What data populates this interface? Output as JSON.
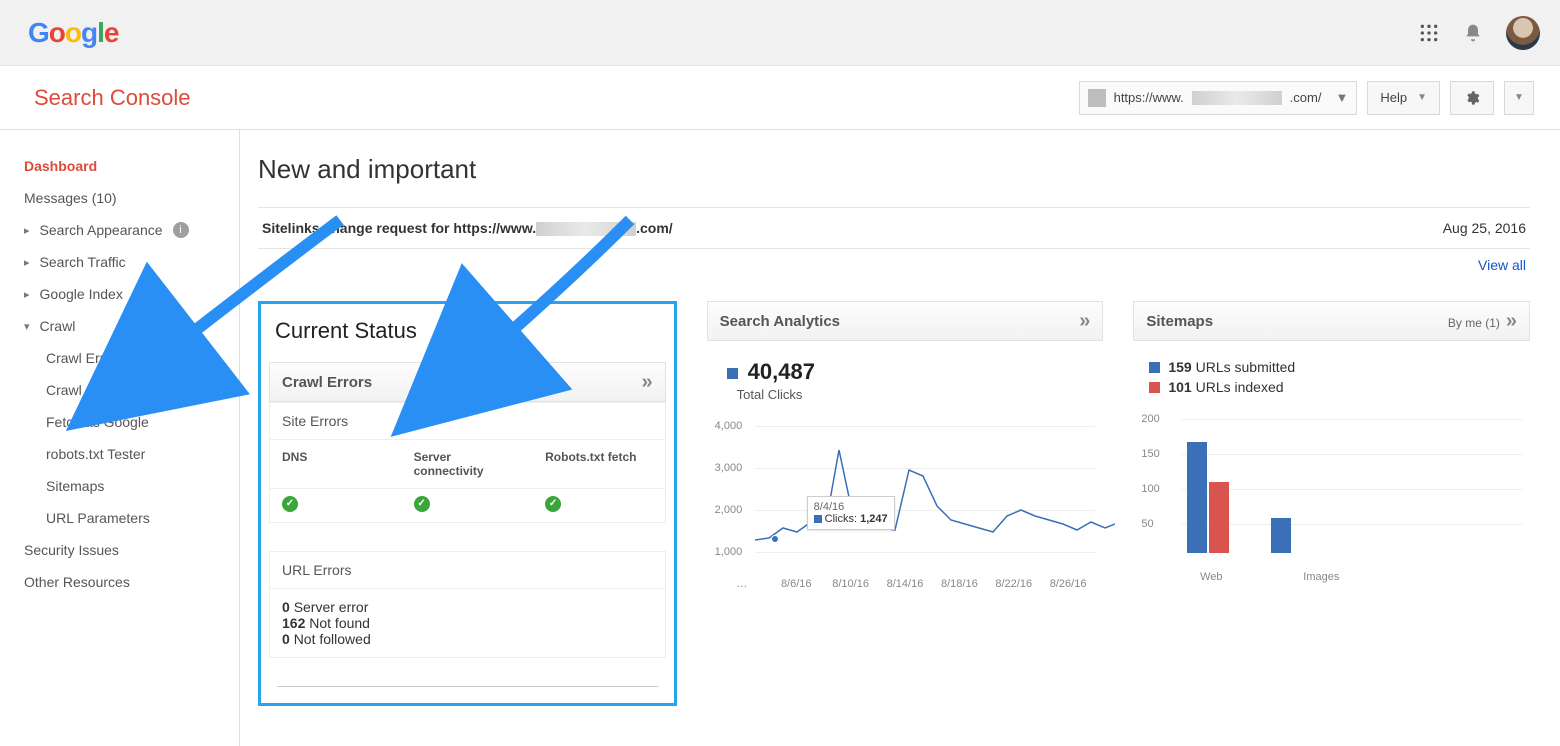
{
  "header": {
    "product_name": "Search Console",
    "help_label": "Help"
  },
  "site_picker": {
    "prefix": "https://www.",
    "suffix": ".com/"
  },
  "sidebar": {
    "dashboard": "Dashboard",
    "messages": "Messages (10)",
    "search_appearance": "Search Appearance",
    "search_traffic": "Search Traffic",
    "google_index": "Google Index",
    "crawl": "Crawl",
    "crawl_items": {
      "errors": "Crawl Errors",
      "stats": "Crawl Stats",
      "fetch": "Fetch as Google",
      "robots": "robots.txt Tester",
      "sitemaps": "Sitemaps",
      "url_params": "URL Parameters"
    },
    "security": "Security Issues",
    "other": "Other Resources"
  },
  "page": {
    "title": "New and important",
    "message_prefix": "Sitelinks change request for https://www.",
    "message_suffix": ".com/",
    "message_date": "Aug 25, 2016",
    "view_all": "View all"
  },
  "crawl_card": {
    "current_status": "Current Status",
    "title": "Crawl Errors",
    "site_errors_label": "Site Errors",
    "dns": "DNS",
    "server": "Server connectivity",
    "robots": "Robots.txt fetch",
    "url_errors_label": "URL Errors",
    "errors": [
      {
        "count": "0",
        "label": "Server error"
      },
      {
        "count": "162",
        "label": "Not found"
      },
      {
        "count": "0",
        "label": "Not followed"
      }
    ]
  },
  "analytics_card": {
    "title": "Search Analytics",
    "total": "40,487",
    "total_label": "Total Clicks",
    "tooltip_date": "8/4/16",
    "tooltip_label": "Clicks:",
    "tooltip_value": "1,247"
  },
  "sitemaps_card": {
    "title": "Sitemaps",
    "byme": "By me (1)",
    "submitted_n": "159",
    "submitted_label": "URLs submitted",
    "indexed_n": "101",
    "indexed_label": "URLs indexed"
  },
  "chart_data": [
    {
      "type": "line",
      "title": "Total Clicks",
      "ylabel": "Clicks",
      "ylim": [
        1000,
        4000
      ],
      "yticks": [
        1000,
        2000,
        3000,
        4000
      ],
      "x_categories": [
        "…",
        "8/6/16",
        "8/10/16",
        "8/14/16",
        "8/18/16",
        "8/22/16",
        "8/26/16"
      ],
      "series": [
        {
          "name": "Clicks",
          "color": "#3b6fb6",
          "values": [
            1250,
            1300,
            1500,
            1400,
            1600,
            1500,
            3200,
            1700,
            1550,
            1500,
            1450,
            2700,
            2550,
            1800,
            1600,
            1550,
            1500,
            1400,
            1700,
            1850,
            1700,
            1650,
            1550,
            1450,
            1600,
            1500,
            1550
          ]
        }
      ],
      "tooltip": {
        "date": "8/4/16",
        "label": "Clicks",
        "value": 1247
      }
    },
    {
      "type": "bar",
      "title": "Sitemaps",
      "ylim": [
        0,
        200
      ],
      "yticks": [
        50,
        100,
        150,
        200
      ],
      "categories": [
        "Web",
        "Images"
      ],
      "series": [
        {
          "name": "URLs submitted",
          "color": "#3b6fb6",
          "values": [
            159,
            50
          ]
        },
        {
          "name": "URLs indexed",
          "color": "#d9534f",
          "values": [
            101,
            0
          ]
        }
      ]
    }
  ]
}
